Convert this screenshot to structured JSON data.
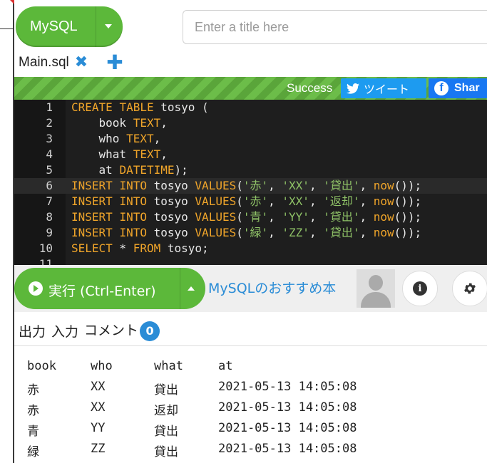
{
  "header": {
    "language_label": "MySQL",
    "title_placeholder": "Enter a title here"
  },
  "file_tab": {
    "name": "Main.sql"
  },
  "status": {
    "text": "Success",
    "tweet_label": "ツイート",
    "share_label": "Shar"
  },
  "editor": {
    "line_numbers": [
      "1",
      "2",
      "3",
      "4",
      "5",
      "6",
      "7",
      "8",
      "9",
      "10",
      "11"
    ],
    "lines": [
      "CREATE TABLE tosyo (",
      "    book TEXT,",
      "    who TEXT,",
      "    what TEXT,",
      "    at DATETIME);",
      "INSERT INTO tosyo VALUES('赤', 'XX', '貸出', now());",
      "INSERT INTO tosyo VALUES('赤', 'XX', '返却', now());",
      "INSERT INTO tosyo VALUES('青', 'YY', '貸出', now());",
      "INSERT INTO tosyo VALUES('緑', 'ZZ', '貸出', now());",
      "SELECT * FROM tosyo;",
      ""
    ]
  },
  "run": {
    "label": "実行 (Ctrl-Enter)",
    "book_link": "MySQLのおすすめ本"
  },
  "output": {
    "tabs": [
      "出力",
      "入力",
      "コメント"
    ],
    "comment_count": "0",
    "columns": [
      "book",
      "who",
      "what",
      "at"
    ],
    "rows": [
      [
        "赤",
        "XX",
        "貸出",
        "2021-05-13 14:05:08"
      ],
      [
        "赤",
        "XX",
        "返却",
        "2021-05-13 14:05:08"
      ],
      [
        "青",
        "YY",
        "貸出",
        "2021-05-13 14:05:08"
      ],
      [
        "緑",
        "ZZ",
        "貸出",
        "2021-05-13 14:05:08"
      ]
    ]
  },
  "colors": {
    "green": "#5cb83a",
    "blue": "#2a8cd6",
    "editor_bg": "#1e1e1e",
    "keyword": "#f0a52a",
    "string": "#8fc267"
  }
}
